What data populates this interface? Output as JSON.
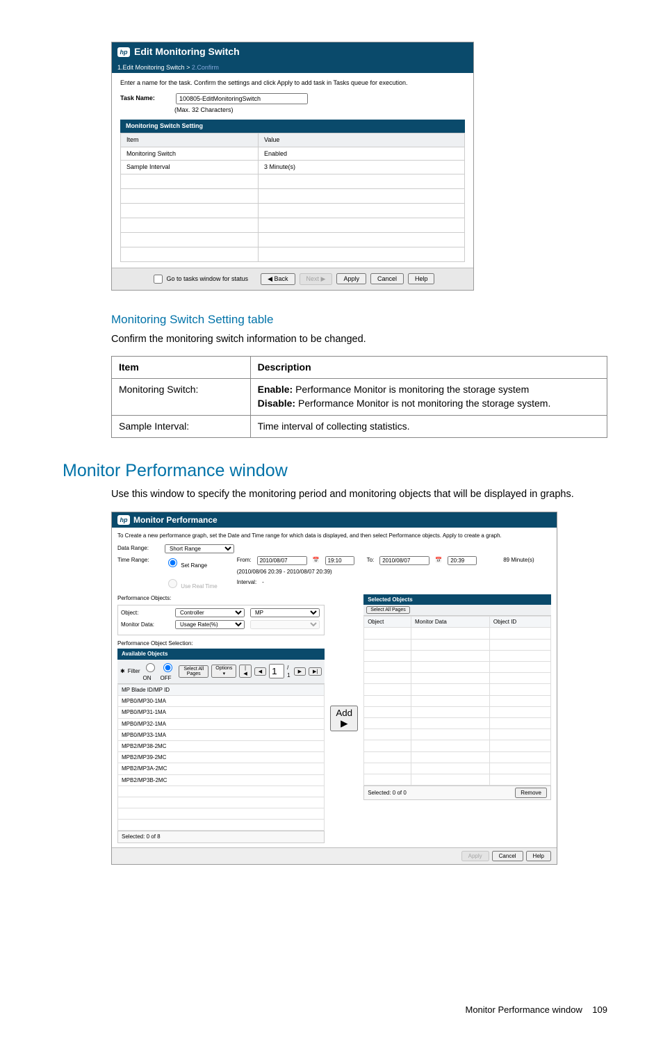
{
  "dialog1": {
    "title": "Edit Monitoring Switch",
    "breadcrumb_step1": "1.Edit Monitoring Switch",
    "breadcrumb_sep": ">",
    "breadcrumb_step2": "2.Confirm",
    "instruction": "Enter a name for the task. Confirm the settings and click Apply to add task in Tasks queue for execution.",
    "task_name_label": "Task Name:",
    "task_name_value": "100805-EditMonitoringSwitch",
    "max_chars": "(Max. 32 Characters)",
    "settings_header": "Monitoring Switch Setting",
    "col_item": "Item",
    "col_value": "Value",
    "row1_item": "Monitoring Switch",
    "row1_value": "Enabled",
    "row2_item": "Sample Interval",
    "row2_value": "3 Minute(s)",
    "goto_tasks": "Go to tasks window for status",
    "btn_back": "◀ Back",
    "btn_next": "Next ▶",
    "btn_apply": "Apply",
    "btn_cancel": "Cancel",
    "btn_help": "Help"
  },
  "heading1": "Monitoring Switch Setting table",
  "text1": "Confirm the monitoring switch information to be changed.",
  "doctable": {
    "h1": "Item",
    "h2": "Description",
    "r1c1": "Monitoring Switch:",
    "r1_enable_label": "Enable:",
    "r1_enable_text": " Performance Monitor is monitoring the storage system",
    "r1_disable_label": "Disable:",
    "r1_disable_text": " Performance Monitor is not monitoring the storage system.",
    "r2c1": "Sample Interval:",
    "r2c2": "Time interval of collecting statistics."
  },
  "heading2": "Monitor Performance window",
  "text2": "Use this window to specify the monitoring period and monitoring objects that will be displayed in graphs.",
  "dialog2": {
    "title": "Monitor Performance",
    "instruction": "To Create a new performance graph, set the Date and Time range for which data is displayed, and then select Performance objects. Apply to create a graph.",
    "data_range_label": "Data Range:",
    "data_range_value": "Short Range",
    "time_range_label": "Time Range:",
    "set_range": "Set Range",
    "use_real_time": "Use Real Time",
    "from_label": "From:",
    "from_date": "2010/08/07",
    "from_time": "19:10",
    "to_label": "To:",
    "to_date": "2010/08/07",
    "to_time": "20:39",
    "range_minutes": "89  Minute(s)",
    "range_detail": "(2010/08/06 20:39 - 2010/08/07 20:39)",
    "interval_label": "Interval:",
    "interval_value": "-",
    "perf_objects_label": "Performance Objects:",
    "object_label": "Object:",
    "object_sel1": "Controller",
    "object_sel2": "MP",
    "monitor_data_label": "Monitor Data:",
    "monitor_sel1": "Usage Rate(%)",
    "monitor_sel2": "",
    "selection_header": "Performance Object Selection:",
    "available_header": "Available Objects",
    "filter_label": "Filter",
    "on": "ON",
    "off": "OFF",
    "select_all_pages": "Select All Pages",
    "options": "Options ▾",
    "pager_prev": "|◀",
    "pager_p": "◀",
    "pager_pos": "/ 1",
    "pager_n": "▶",
    "pager_next": "▶|",
    "col_mp": "MP Blade ID/MP ID",
    "items": [
      "MPB0/MP30-1MA",
      "MPB0/MP31-1MA",
      "MPB0/MP32-1MA",
      "MPB0/MP33-1MA",
      "MPB2/MP38-2MC",
      "MPB2/MP39-2MC",
      "MPB2/MP3A-2MC",
      "MPB2/MP3B-2MC"
    ],
    "selected_left": "Selected: 0   of 8",
    "add_btn": "Add ▶",
    "selected_header": "Selected Objects",
    "sel_col_object": "Object",
    "sel_col_mdata": "Monitor Data",
    "sel_col_oid": "Object ID",
    "selected_right": "Selected: 0   of 0",
    "remove_btn": "Remove",
    "footer_apply": "Apply",
    "footer_cancel": "Cancel",
    "footer_help": "Help"
  },
  "page_footer_text": "Monitor Performance window",
  "page_number": "109"
}
